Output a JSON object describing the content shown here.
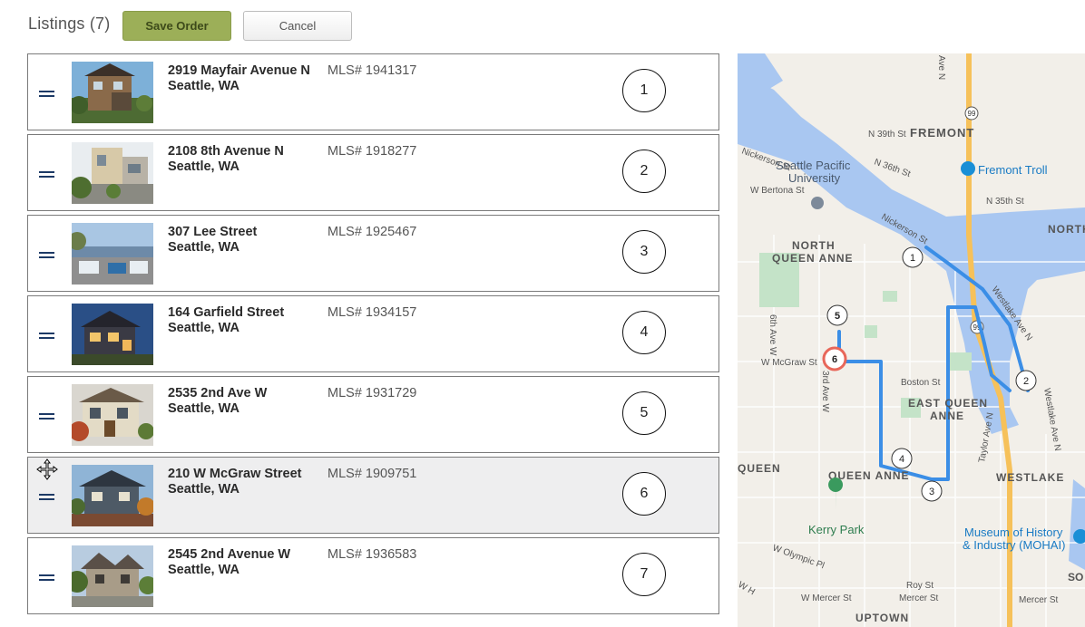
{
  "header": {
    "title": "Listings (7)",
    "save_label": "Save Order",
    "cancel_label": "Cancel"
  },
  "listings": [
    {
      "address_line1": "2919 Mayfair Avenue N",
      "address_line2": "Seattle, WA",
      "mls": "MLS# 1941317",
      "order": "1"
    },
    {
      "address_line1": "2108 8th Avenue N",
      "address_line2": "Seattle, WA",
      "mls": "MLS# 1918277",
      "order": "2"
    },
    {
      "address_line1": "307 Lee Street",
      "address_line2": "Seattle, WA",
      "mls": "MLS# 1925467",
      "order": "3"
    },
    {
      "address_line1": "164 Garfield Street",
      "address_line2": "Seattle, WA",
      "mls": "MLS# 1934157",
      "order": "4"
    },
    {
      "address_line1": "2535 2nd Ave W",
      "address_line2": "Seattle, WA",
      "mls": "MLS# 1931729",
      "order": "5"
    },
    {
      "address_line1": "210 W McGraw Street",
      "address_line2": "Seattle, WA",
      "mls": "MLS# 1909751",
      "order": "6"
    },
    {
      "address_line1": "2545 2nd Avenue W",
      "address_line2": "Seattle, WA",
      "mls": "MLS# 1936583",
      "order": "7"
    }
  ],
  "map": {
    "labels": {
      "fremont": "FREMONT",
      "fremont_troll": "Fremont Troll",
      "spu": "Seattle Pacific",
      "spu2": "University",
      "north_qa": "NORTH",
      "north_qa2": "QUEEN ANNE",
      "east_qa": "EAST QUEEN",
      "east_qa2": "ANNE",
      "queen_anne": "QUEEN ANNE",
      "queen_anne_left": "QUEEN",
      "westlake": "WESTLAKE",
      "north_edge": "NORTH",
      "kerry_park": "Kerry Park",
      "museum": "Museum of History",
      "museum2": "& Industry (MOHAI)",
      "uptown": "UPTOWN",
      "so_edge": "SO",
      "n39": "N 39th St",
      "n36": "N 36th St",
      "n35": "N 35th St",
      "nickerson1": "Nickerson St",
      "nickerson2": "Nickerson St",
      "bertona": "W Bertona St",
      "mcgraw": "W McGraw St",
      "boston": "Boston St",
      "westlake_ave": "Westlake Ave N",
      "westlake_ave2": "Westlake Ave N",
      "ave6": "6th Ave W",
      "ave3": "3rd Ave W",
      "taylor": "Taylor Ave N",
      "olympic": "W Olympic Pl",
      "roy": "Roy St",
      "mercer_w": "W Mercer St",
      "mercer": "Mercer St",
      "mercer_e": "Mercer St",
      "ave_n_top": "Ave N",
      "hwy99": "99",
      "wh": "W H"
    },
    "markers": [
      "1",
      "2",
      "3",
      "4",
      "5",
      "6"
    ],
    "route_color": "#3b8ee6",
    "active_marker_color": "#e8675a"
  }
}
